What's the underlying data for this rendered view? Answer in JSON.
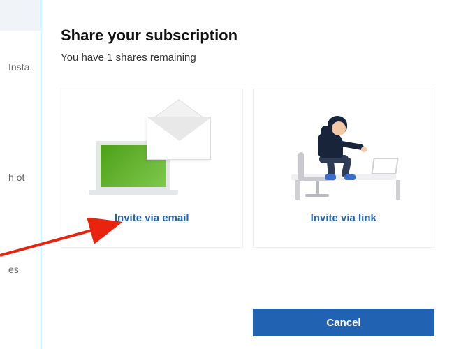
{
  "dialog": {
    "title": "Share your subscription",
    "subtitle": "You have 1 shares remaining"
  },
  "cards": {
    "email": {
      "label": "Invite via email"
    },
    "link": {
      "label": "Invite via link"
    }
  },
  "buttons": {
    "cancel": "Cancel"
  },
  "background": {
    "text1": "Insta",
    "text2": "h ot",
    "text3": "es"
  },
  "colors": {
    "accent": "#2262b3"
  }
}
